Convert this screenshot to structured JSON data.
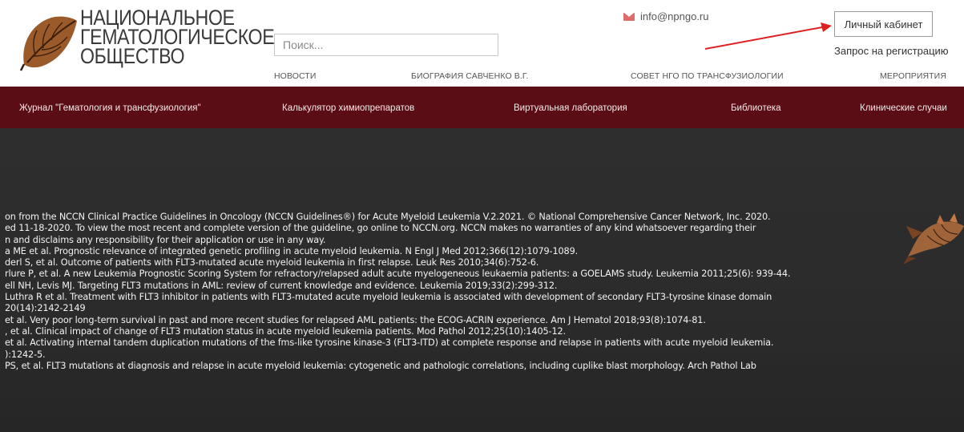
{
  "header": {
    "logo_lines": [
      "НАЦИОНАЛЬНОЕ",
      "ГЕМАТОЛОГИЧЕСКОЕ",
      "ОБЩЕСТВО"
    ],
    "logo_icon": "leaf-logo-icon",
    "search_placeholder": "Поиск...",
    "email": "info@npngo.ru",
    "cabinet_label": "Личный кабинет",
    "register_label": "Запрос на регистрацию",
    "accent_color": "#5b0d16",
    "arrow_color": "#e02020"
  },
  "subnav": [
    "НОВОСТИ",
    "БИОГРАФИЯ САВЧЕНКО В.Г.",
    "СОВЕТ НГО ПО ТРАНСФУЗИОЛОГИИ",
    "МЕРОПРИЯТИЯ"
  ],
  "mainnav": [
    "Журнал \"Гематология и трансфузиология\"",
    "Калькулятор химиопрепаратов",
    "Виртуальная лаборатория",
    "Библиотека",
    "Клинические случаи"
  ],
  "references": [
    "on from the NCCN Clinical Practice Guidelines in Oncology (NCCN Guidelines®) for Acute Myeloid Leukemia V.2.2021. © National Comprehensive Cancer Network, Inc. 2020.",
    "ed 11-18-2020. To view the most recent and complete version of the guideline, go online to NCCN.org. NCCN makes no warranties of any kind whatsoever regarding their",
    "n and disclaims any responsibility for their application or use in any way.",
    "a ME et al. Prognostic relevance of integrated genetic profiling in acute myeloid leukemia. N Engl J Med 2012;366(12):1079-1089.",
    "derl S, et al. Outcome of patients with FLT3-mutated acute myeloid leukemia in first relapse.  Leuk Res 2010;34(6):752-6.",
    "rlure P, et al. A new Leukemia Prognostic Scoring System  for refractory/relapsed adult acute myelogeneous leukaemia patients: a GOELAMS study. Leukemia 2011;25(6): 939-44.",
    "ell NH, Levis MJ. Targeting FLT3 mutations in AML: review of current knowledge and evidence. Leukemia 2019;33(2):299-312.",
    " Luthra R et al. Treatment with FLT3 inhibitor in patients with FLT3-mutated acute myeloid leukemia is associated with development of secondary FLT3-tyrosine kinase domain",
    "20(14):2142-2149",
    "et al. Very poor long-term survival in past and more recent studies for relapsed AML patients: the ECOG-ACRIN experience. Am J Hematol 2018;93(8):1074-81.",
    ", et al. Clinical impact of change of FLT3 mutation status in acute myeloid leukemia patients. Mod Pathol 2012;25(10):1405-12.",
    " et al. Activating internal tandem duplication mutations of the fms-like tyrosine kinase-3 (FLT3-ITD) at complete response and relapse in patients with acute myeloid leukemia.",
    "):1242-5.",
    "PS, et al. FLT3 mutations at diagnosis and relapse in acute myeloid leukemia: cytogenetic and pathologic correlations, including cuplike blast morphology. Arch Pathol Lab"
  ]
}
